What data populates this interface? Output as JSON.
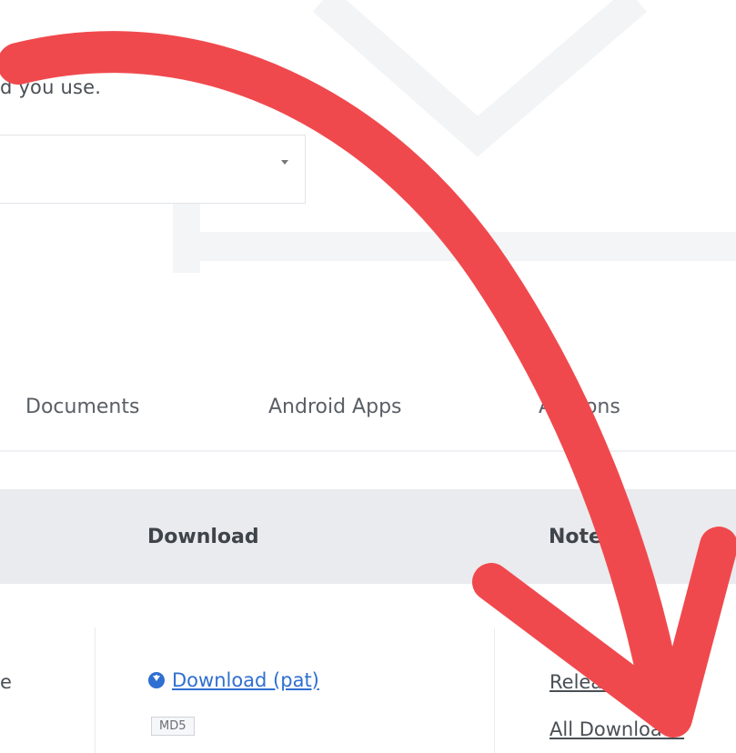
{
  "model_selector": {
    "hint_text": "d you use.",
    "selected_value": ""
  },
  "tabs": [
    {
      "label": "Documents"
    },
    {
      "label": "Android Apps"
    },
    {
      "label": "Add-ons"
    }
  ],
  "table": {
    "headers": {
      "download": "Download",
      "notes": "Notes"
    },
    "row": {
      "first_col_partial": "e",
      "download_link": "Download (pat)",
      "md5_label": "MD5",
      "release_notes_link": "Release Note",
      "all_downloads_link": "All Downloads"
    }
  },
  "colors": {
    "accent": "#2f6fd1",
    "arrow": "#f0494d",
    "header_bg": "#e9ebee"
  },
  "icons": {
    "download": "download-circle-icon",
    "dropdown": "chevron-down-icon",
    "annotation": "curved-arrow-icon"
  }
}
